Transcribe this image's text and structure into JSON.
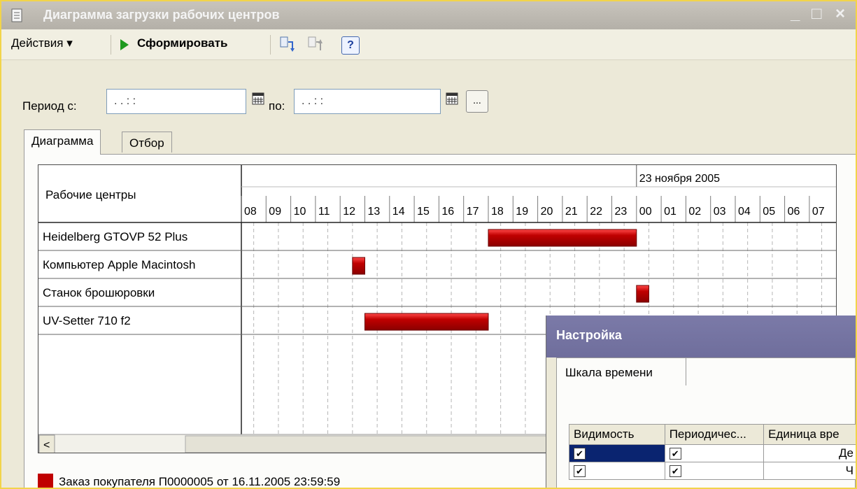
{
  "window": {
    "title": "Диаграмма загрузки рабочих центров",
    "controls": [
      "_",
      "□",
      "×"
    ]
  },
  "toolbar": {
    "actions_label": "Действия ▾",
    "form_label": "Сформировать",
    "help_label": "?"
  },
  "period": {
    "from_label": "Период с:",
    "from_value": " .  .     : :",
    "to_label": "по:",
    "to_value": " .  .     : :",
    "dots_label": "..."
  },
  "tabs": [
    {
      "label": "Диаграмма",
      "active": true
    },
    {
      "label": "Отбор",
      "active": false
    }
  ],
  "chart_data": {
    "type": "gantt",
    "row_header": "Рабочие центры",
    "date_label": "23 ноября 2005",
    "hours": [
      "08",
      "09",
      "10",
      "11",
      "12",
      "13",
      "14",
      "15",
      "16",
      "17",
      "18",
      "19",
      "20",
      "21",
      "22",
      "23",
      "00",
      "01",
      "02",
      "03",
      "04",
      "05",
      "06",
      "07"
    ],
    "rows": [
      {
        "name": "Heidelberg GTOVP 52 Plus",
        "start": 10,
        "end": 16
      },
      {
        "name": "Компьютер Apple Macintosh",
        "start": 4.5,
        "end": 5.0
      },
      {
        "name": "Станок брошюровки",
        "start": 16,
        "end": 16.5
      },
      {
        "name": "UV-Setter 710 f2",
        "start": 5,
        "end": 10
      }
    ],
    "bar_color": "#c00000"
  },
  "scroll": {
    "left_arrow": "<"
  },
  "legend": {
    "text": "Заказ покупателя П0000005 от 16.11.2005 23:59:59",
    "color": "#c00000"
  },
  "dialog": {
    "title": "Настройка",
    "tab_label": "Шкала времени",
    "columns": [
      "Видимость",
      "Периодичес...",
      "Единица вре"
    ],
    "rows": [
      {
        "visible": "✔",
        "periodic": "✔",
        "unit": "Де"
      },
      {
        "visible": "✔",
        "periodic": "✔",
        "unit": "Ч"
      }
    ]
  }
}
